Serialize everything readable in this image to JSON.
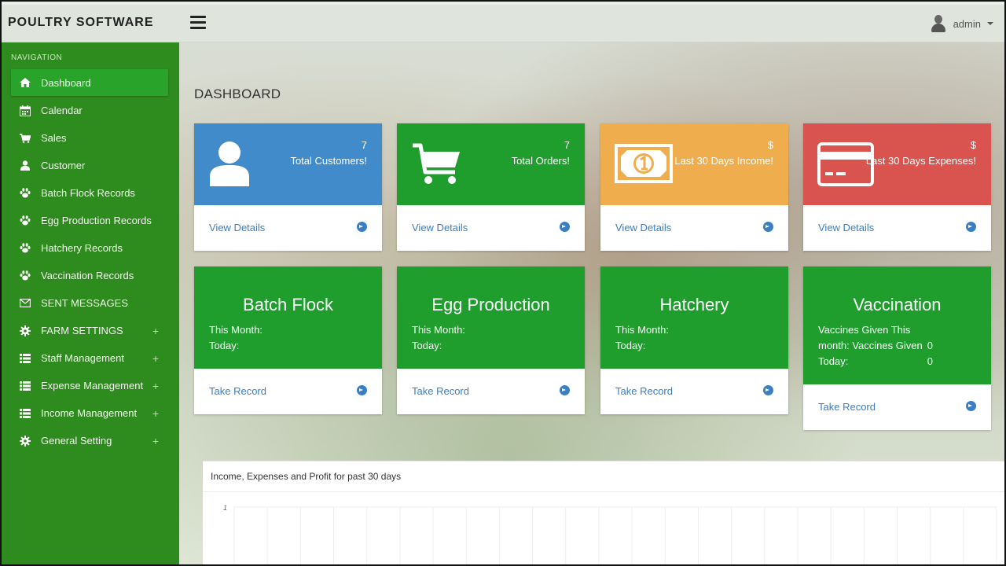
{
  "brand": "POULTRY SOFTWARE",
  "user": {
    "name": "admin"
  },
  "sidebar": {
    "heading": "NAVIGATION",
    "items": [
      {
        "label": "Dashboard",
        "icon": "home-icon",
        "active": true
      },
      {
        "label": "Calendar",
        "icon": "calendar-icon"
      },
      {
        "label": "Sales",
        "icon": "cart-icon"
      },
      {
        "label": "Customer",
        "icon": "user-icon"
      },
      {
        "label": "Batch Flock Records",
        "icon": "paw-icon"
      },
      {
        "label": "Egg Production Records",
        "icon": "paw-icon"
      },
      {
        "label": "Hatchery Records",
        "icon": "paw-icon"
      },
      {
        "label": "Vaccination Records",
        "icon": "paw-icon"
      },
      {
        "label": "SENT MESSAGES",
        "icon": "envelope-icon"
      },
      {
        "label": "FARM SETTINGS",
        "icon": "gear-icon",
        "expand": "+"
      },
      {
        "label": "Staff Management",
        "icon": "list-icon",
        "expand": "+"
      },
      {
        "label": "Expense Management",
        "icon": "list-icon",
        "expand": "+"
      },
      {
        "label": "Income Management",
        "icon": "list-icon",
        "expand": "+"
      },
      {
        "label": "General Setting",
        "icon": "gear-icon",
        "expand": "+"
      }
    ]
  },
  "main": {
    "title": "DASHBOARD",
    "stat_cards": [
      {
        "value": "7",
        "label": "Total Customers!",
        "link": "View Details",
        "color": "#428bca",
        "icon": "user-icon"
      },
      {
        "value": "7",
        "label": "Total Orders!",
        "link": "View Details",
        "color": "#1f9e2e",
        "icon": "cart-icon"
      },
      {
        "value": "$",
        "label": "Last 30 Days Income!",
        "link": "View Details",
        "color": "#f0ad4e",
        "icon": "money-icon"
      },
      {
        "value": "$",
        "label": "Last 30 Days Expenses!",
        "link": "View Details",
        "color": "#d9534f",
        "icon": "credit-card-icon"
      }
    ],
    "record_cards": [
      {
        "title": "Batch Flock",
        "line1": "This Month:",
        "line2": "Today:",
        "link": "Take Record"
      },
      {
        "title": "Egg Production",
        "line1": "This Month:",
        "line2": "Today:",
        "link": "Take Record"
      },
      {
        "title": "Hatchery",
        "line1": "This Month:",
        "line2": "Today:",
        "link": "Take Record"
      },
      {
        "title": "Vaccination",
        "line1": "Vaccines Given This",
        "line2": "month: Vaccines Given",
        "line3": "Today:",
        "value1": "0",
        "value2": "0",
        "link": "Take Record"
      }
    ],
    "chart": {
      "title": "Income, Expenses and Profit for past 30 days"
    }
  },
  "chart_data": {
    "type": "line",
    "title": "Income, Expenses and Profit for past 30 days",
    "y_tick_labels": [
      "1"
    ],
    "grid": true
  }
}
